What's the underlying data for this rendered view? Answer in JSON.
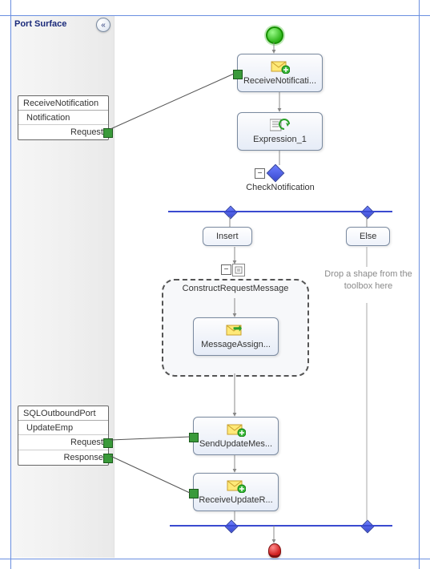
{
  "header": {
    "port_surface_label": "Port Surface",
    "collapse_glyph": "«"
  },
  "ports": {
    "receive_notification": {
      "title": "ReceiveNotification",
      "operation": "Notification",
      "message": "Request"
    },
    "sql_outbound": {
      "title": "SQLOutboundPort",
      "operation": "UpdateEmp",
      "request": "Request",
      "response": "Response"
    }
  },
  "shapes": {
    "receive_notification": "ReceiveNotificati...",
    "expression": "Expression_1",
    "check_notification": "CheckNotification",
    "branch_insert": "Insert",
    "branch_else": "Else",
    "construct_request": "ConstructRequestMessage",
    "message_assign": "MessageAssign...",
    "send_update": "SendUpdateMes...",
    "receive_update": "ReceiveUpdateR...",
    "drop_placeholder": "Drop a shape from the toolbox here"
  },
  "icons": {
    "envelope_plus": "envelope-plus-icon",
    "expression": "expression-icon",
    "envelope_arrow": "envelope-arrow-icon",
    "scope_doc": "scope-doc-icon"
  },
  "colors": {
    "guide_blue": "#6a8fe0",
    "port_green": "#3a9a3a",
    "decision_blue": "#3a4ad0"
  }
}
